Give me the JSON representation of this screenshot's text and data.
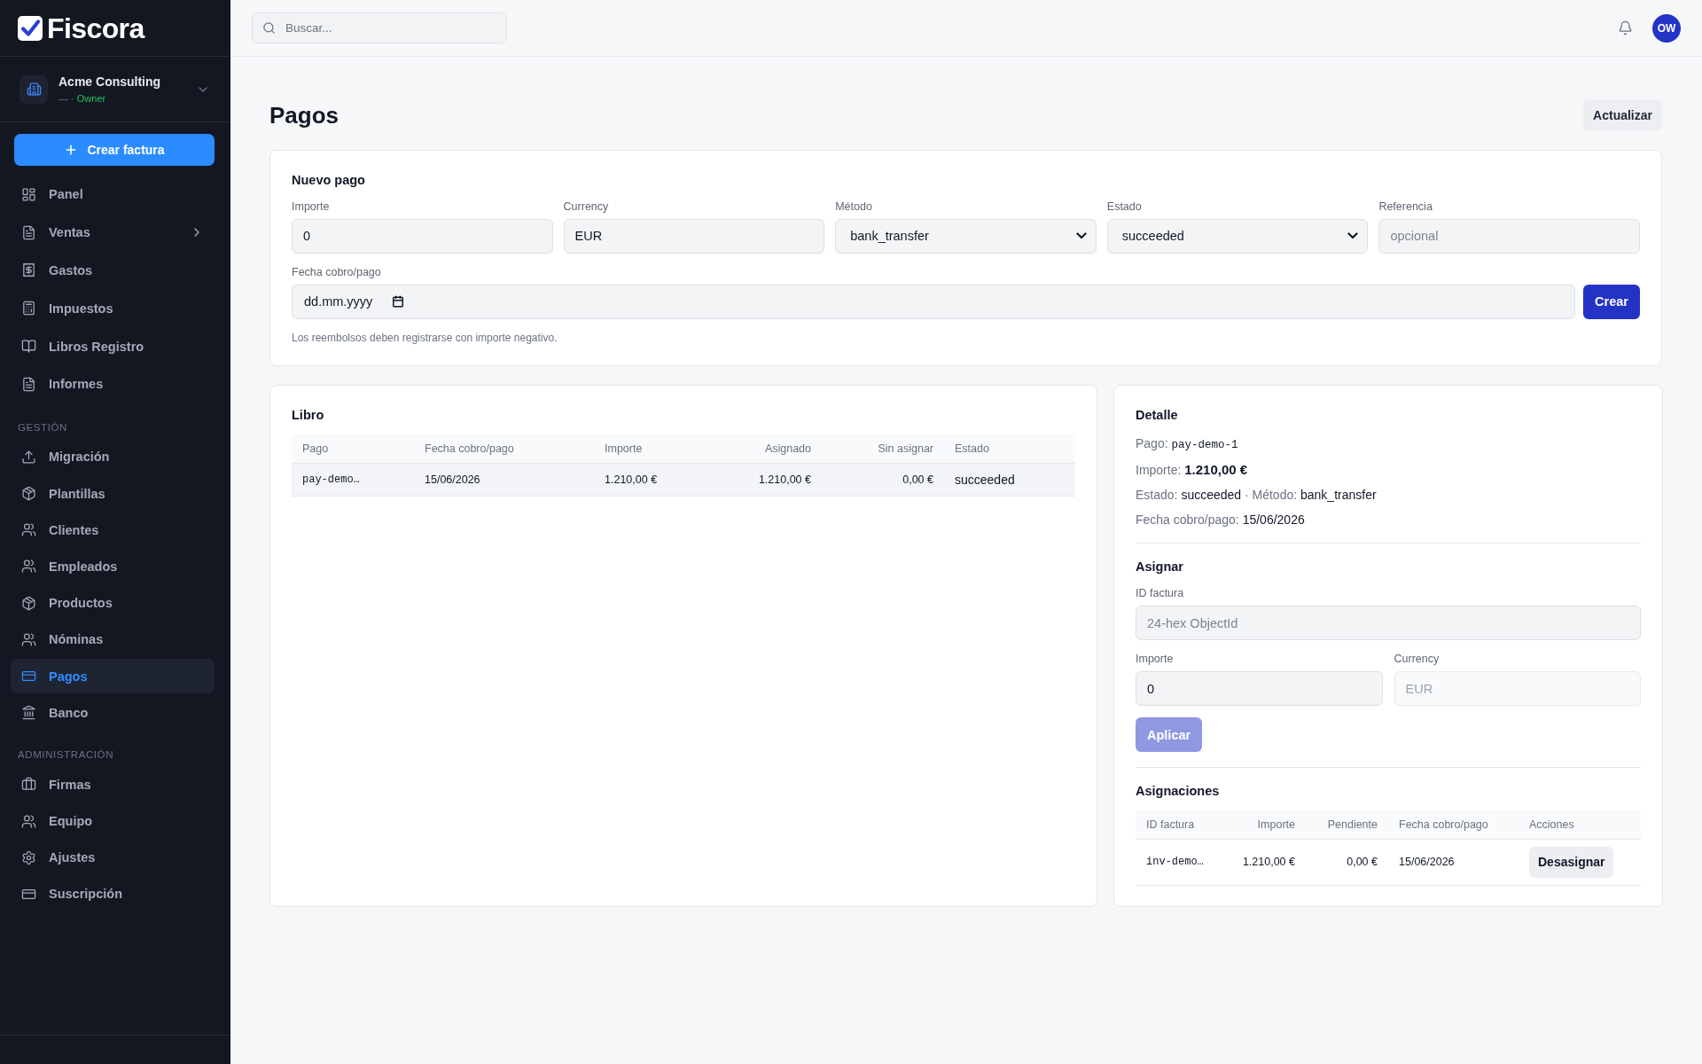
{
  "sidebar": {
    "logo": "Fiscora",
    "workspace": {
      "name": "Acme Consulting",
      "subtitle": "— ·",
      "role": "Owner"
    },
    "create_button": "Crear factura",
    "sections": [
      {
        "items": [
          {
            "label": "Panel",
            "kind": "link",
            "selected": false
          },
          {
            "label": "Ventas",
            "kind": "group",
            "selected": false
          },
          {
            "label": "Gastos",
            "kind": "link",
            "selected": false
          },
          {
            "label": "Impuestos",
            "kind": "link",
            "selected": false
          },
          {
            "label": "Libros Registro",
            "kind": "link",
            "selected": false
          },
          {
            "label": "Informes",
            "kind": "link",
            "selected": false
          }
        ]
      },
      {
        "heading": "GESTIÓN",
        "items": [
          {
            "label": "Migración",
            "kind": "link",
            "selected": false
          },
          {
            "label": "Plantillas",
            "kind": "link",
            "selected": false
          },
          {
            "label": "Clientes",
            "kind": "link",
            "selected": false
          },
          {
            "label": "Empleados",
            "kind": "link",
            "selected": false
          },
          {
            "label": "Productos",
            "kind": "link",
            "selected": false
          },
          {
            "label": "Nóminas",
            "kind": "link",
            "selected": false
          },
          {
            "label": "Pagos",
            "kind": "link",
            "selected": true
          },
          {
            "label": "Banco",
            "kind": "link",
            "selected": false
          }
        ]
      },
      {
        "heading": "ADMINISTRACIÓN",
        "items": [
          {
            "label": "Firmas",
            "kind": "link",
            "selected": false
          },
          {
            "label": "Equipo",
            "kind": "link",
            "selected": false
          },
          {
            "label": "Ajustes",
            "kind": "link",
            "selected": false
          },
          {
            "label": "Suscripción",
            "kind": "link",
            "selected": false
          }
        ]
      }
    ]
  },
  "topbar": {
    "search": {
      "placeholder": "Buscar..."
    },
    "avatar": "OW"
  },
  "header": {
    "title": "Pagos",
    "refresh_button": "Actualizar"
  },
  "new_payment": {
    "title": "Nuevo pago",
    "fields": [
      {
        "label": "Importe",
        "kind": "input",
        "value": "0"
      },
      {
        "label": "Currency",
        "kind": "input",
        "value": "EUR"
      },
      {
        "label": "Método",
        "kind": "select",
        "value": "bank_transfer"
      },
      {
        "label": "Estado",
        "kind": "select",
        "value": "succeeded"
      },
      {
        "label": "Referencia",
        "kind": "input",
        "placeholder": "opcional"
      }
    ],
    "date_field": {
      "label": "Fecha cobro/pago",
      "placeholder": "dd.mm.yyyy"
    },
    "submit_button": "Crear",
    "note": "Los reembolsos deben registrarse con importe negativo."
  },
  "ledger": {
    "title": "Libro",
    "columns": [
      "Pago",
      "Fecha cobro/pago",
      "Importe",
      "Asignado",
      "Sin asignar",
      "Estado"
    ],
    "rows": [
      {
        "cells": [
          "pay-demo…",
          "15/06/2026",
          "1.210,00 €",
          "1.210,00 €",
          "0,00 €",
          "succeeded"
        ],
        "selected": true
      }
    ]
  },
  "detail": {
    "title": "Detalle",
    "lines": [
      {
        "parts": [
          {
            "label": "Pago:",
            "value": "pay-demo-1",
            "kind": "mono"
          }
        ]
      },
      {
        "parts": [
          {
            "label": "Importe:",
            "value": "1.210,00 €",
            "kind": "bold"
          }
        ]
      },
      {
        "parts": [
          {
            "label": "Estado:",
            "value": "succeeded",
            "kind": "plain"
          },
          {
            "label": "· Método:",
            "value": "bank_transfer",
            "kind": "plain"
          }
        ]
      },
      {
        "parts": [
          {
            "label": "Fecha cobro/pago:",
            "value": "15/06/2026",
            "kind": "plain"
          }
        ]
      }
    ],
    "assign": {
      "title": "Asignar",
      "invoice_field": {
        "label": "ID factura",
        "placeholder": "24-hex ObjectId"
      },
      "amount_field": {
        "label": "Importe",
        "value": "0"
      },
      "currency_field": {
        "label": "Currency",
        "value": "EUR",
        "disabled": true
      },
      "apply_button": {
        "label": "Aplicar",
        "disabled": true
      }
    },
    "allocations": {
      "title": "Asignaciones",
      "columns": [
        "ID factura",
        "Importe",
        "Pendiente",
        "Fecha cobro/pago",
        "Acciones"
      ],
      "rows": [
        {
          "cells": [
            "inv-demo…",
            "1.210,00 €",
            "0,00 €",
            "15/06/2026"
          ],
          "action": "Desasignar"
        }
      ]
    }
  }
}
